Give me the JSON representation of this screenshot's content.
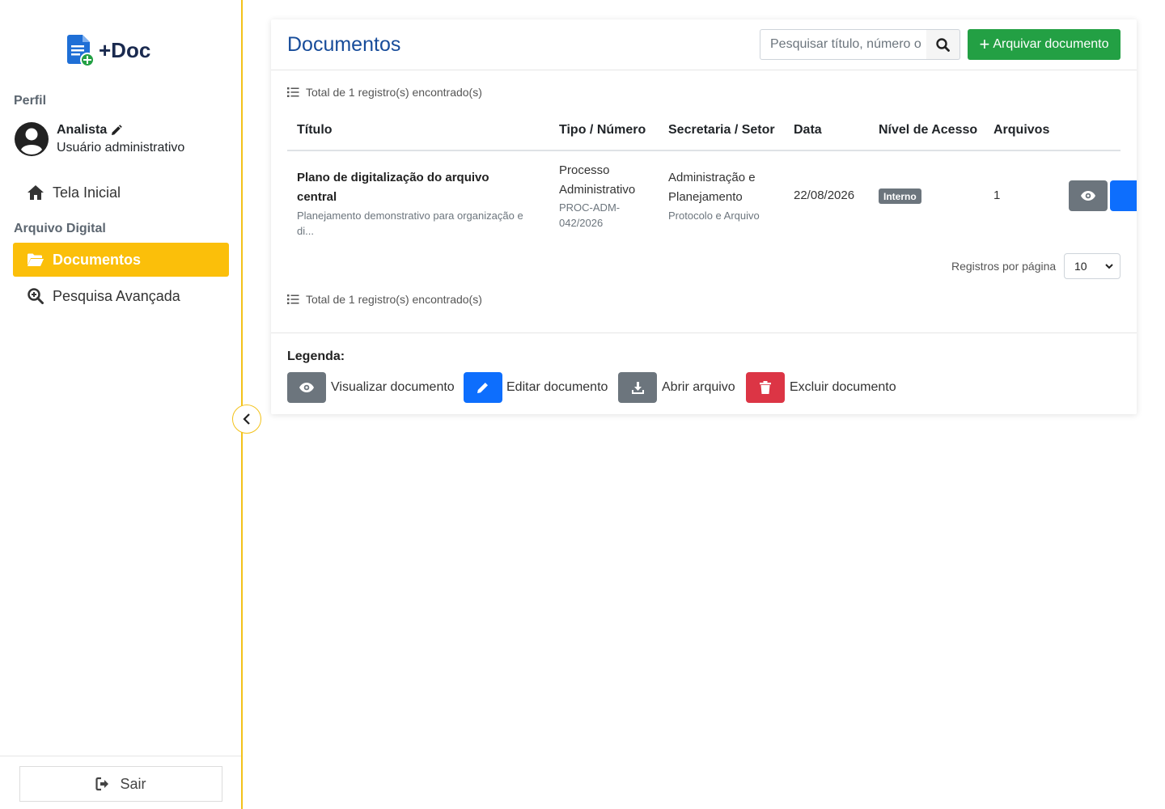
{
  "brand": {
    "name": "+Doc"
  },
  "sidebar": {
    "profile_section": "Perfil",
    "user_name": "Analista",
    "user_role": "Usuário administrativo",
    "home": "Tela Inicial",
    "archive_section": "Arquivo Digital",
    "items": [
      {
        "label": "Documentos",
        "active": true
      },
      {
        "label": "Pesquisa Avançada",
        "active": false
      }
    ],
    "logout": "Sair"
  },
  "colors": {
    "accent": "#fbbf0a",
    "title": "#174c9a",
    "success": "#23a044",
    "primary": "#0d6efd",
    "secondary": "#6c757d",
    "danger": "#dc3545"
  },
  "main": {
    "title": "Documentos",
    "search_placeholder": "Pesquisar título, número o",
    "add_button": "Arquivar documento",
    "total_text": "Total de 1 registro(s) encontrado(s)",
    "columns": [
      "Título",
      "Tipo / Número",
      "Secretaria / Setor",
      "Data",
      "Nível de Acesso",
      "Arquivos"
    ],
    "rows": [
      {
        "title_line1": "Plano de digitalização do arquivo",
        "title_line2": "central",
        "description": "Planejamento demonstrativo para organização e di...",
        "type_line1": "Processo",
        "type_line2": "Administrativo",
        "number_line1": "PROC-ADM-",
        "number_line2": "042/2026",
        "dept_line1": "Administração e",
        "dept_line2": "Planejamento",
        "sector": "Protocolo e Arquivo",
        "date": "22/08/2026",
        "access_level": "Interno",
        "files": "1"
      }
    ],
    "per_page_label": "Registros por página",
    "per_page_value": "10",
    "legend": {
      "title": "Legenda:",
      "view": "Visualizar documento",
      "edit": "Editar documento",
      "open": "Abrir arquivo",
      "delete": "Excluir documento"
    }
  }
}
